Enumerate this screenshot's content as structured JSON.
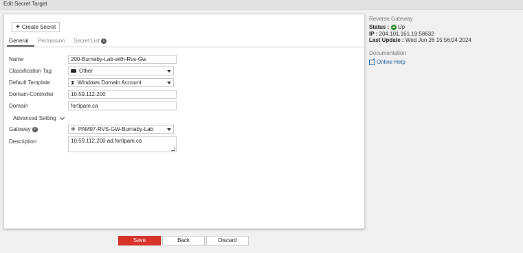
{
  "window": {
    "title": "Edit Secret Target"
  },
  "toolbar": {
    "create_label": "Create Secret"
  },
  "tabs": [
    {
      "label": "General"
    },
    {
      "label": "Permission"
    },
    {
      "label": "Secret List"
    }
  ],
  "form": {
    "name": {
      "label": "Name",
      "value": "200-Burnaby-Lab-with-Rvs-Gw"
    },
    "classification_tag": {
      "label": "Classification Tag",
      "value": "Other"
    },
    "default_template": {
      "label": "Default Template",
      "value": "Windows Domain Account"
    },
    "domain_controller": {
      "label": "Domain-Controller",
      "value": "10.59.112.200"
    },
    "domain": {
      "label": "Domain",
      "value": "fortipam.ca"
    },
    "advanced_setting": {
      "label": "Advanced Setting"
    },
    "gateway": {
      "label": "Gateway",
      "value": "PAM97-RVS-GW-Burnaby-Lab"
    },
    "description": {
      "label": "Description",
      "value": "10.59.112.200 ad.fortipam.ca"
    }
  },
  "footer": {
    "save": "Save",
    "back": "Back",
    "discard": "Discard"
  },
  "sidebar": {
    "reverse_gateway": {
      "heading": "Reverse Gateway",
      "status_label": "Status :",
      "status_value": "Up",
      "ip_label": "IP :",
      "ip_value": "204.101.161.19:58632",
      "last_update_label": "Last Update :",
      "last_update_value": "Wed Jun 26 15:56:04 2024"
    },
    "documentation": {
      "heading": "Documentation",
      "online_help": "Online Help"
    }
  },
  "colors": {
    "save": "#d9322b",
    "status_up": "#2a8a2a",
    "link": "#1f5fa0"
  }
}
